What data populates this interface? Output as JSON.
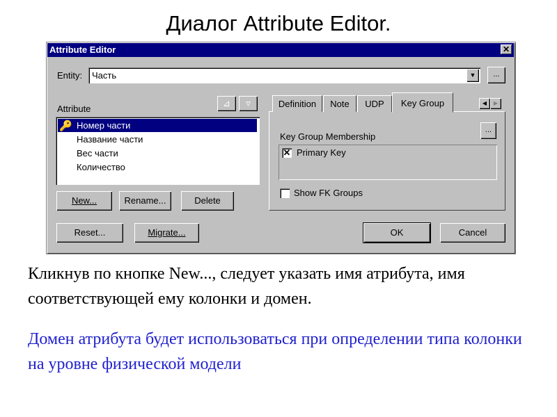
{
  "slide": {
    "title": "Диалог Attribute Editor.",
    "paragraph": "Кликнув по кнопке New..., следует указать имя атрибута, имя соответствующей ему колонки и домен.",
    "note": "Домен атрибута будет использоваться при определении типа колонки на уровне физической модели",
    "note_color": "#1f1fcf"
  },
  "dialog": {
    "title": "Attribute Editor",
    "close": "✕",
    "entity_label": "Entity:",
    "entity_value": "Часть",
    "ellipsis": "...",
    "attribute_label": "Attribute",
    "attributes": [
      "Номер части",
      "Название части",
      "Вес части",
      "Количество"
    ],
    "buttons": {
      "new": "New...",
      "rename": "Rename...",
      "delete": "Delete",
      "reset": "Reset...",
      "migrate": "Migrate...",
      "ok": "OK",
      "cancel": "Cancel"
    },
    "tabs": [
      "Definition",
      "Note",
      "UDP",
      "Key Group"
    ],
    "active_tab": "Key Group",
    "key_group_label": "Key Group Membership",
    "key_groups": [
      {
        "label": "Primary Key",
        "checked": true
      }
    ],
    "show_fk_label": "Show FK Groups",
    "show_fk_checked": false
  }
}
